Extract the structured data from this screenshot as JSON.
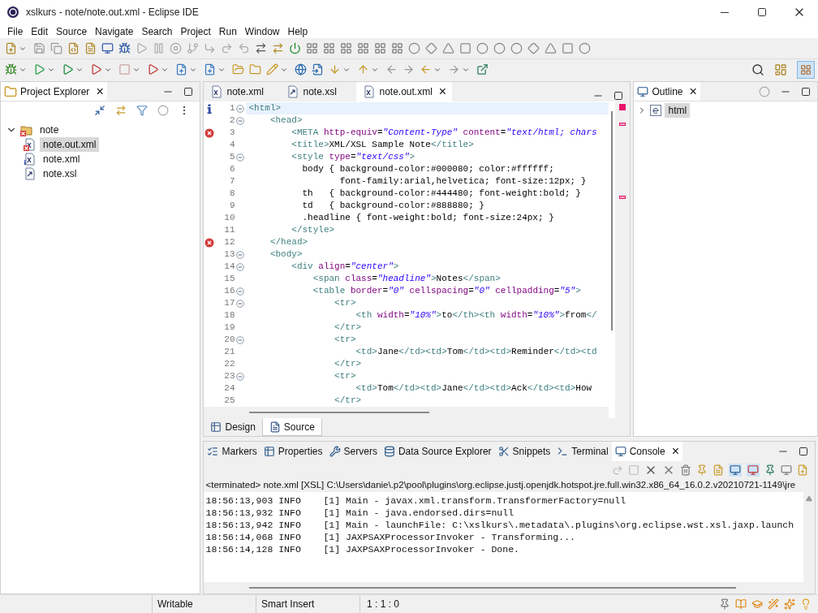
{
  "window": {
    "title": "xslkurs - note/note.out.xml - Eclipse IDE"
  },
  "menu": [
    "File",
    "Edit",
    "Source",
    "Navigate",
    "Search",
    "Project",
    "Run",
    "Window",
    "Help"
  ],
  "project_explorer": {
    "title": "Project Explorer",
    "close": "×",
    "tree": [
      {
        "label": "note",
        "expanded": true,
        "selected": false,
        "error": true,
        "info": false,
        "kind": "project",
        "children": [
          {
            "label": "note.out.xml",
            "selected": true,
            "error": true,
            "info": false,
            "kind": "xml"
          },
          {
            "label": "note.xml",
            "selected": false,
            "error": false,
            "info": true,
            "kind": "xml"
          },
          {
            "label": "note.xsl",
            "selected": false,
            "error": false,
            "info": false,
            "kind": "xsl"
          }
        ]
      }
    ]
  },
  "editor": {
    "tabs": [
      {
        "label": "note.xml",
        "selected": false,
        "kind": "xml"
      },
      {
        "label": "note.xsl",
        "selected": false,
        "kind": "xsl"
      },
      {
        "label": "note.out.xml",
        "selected": true,
        "kind": "xml",
        "close": "×"
      }
    ],
    "lines": [
      {
        "num": "1",
        "fold": true,
        "info": true,
        "error": false,
        "current": true,
        "code": "<html>"
      },
      {
        "num": "2",
        "fold": true,
        "info": false,
        "error": false,
        "current": false,
        "code": "    <head>"
      },
      {
        "num": "3",
        "fold": false,
        "info": false,
        "error": true,
        "current": false,
        "code": "        <META http-equiv=\"Content-Type\" content=\"text/html; chars"
      },
      {
        "num": "4",
        "fold": false,
        "info": false,
        "error": false,
        "current": false,
        "code": "        <title>XML/XSL Sample Note</title>"
      },
      {
        "num": "5",
        "fold": true,
        "info": false,
        "error": false,
        "current": false,
        "code": "        <style type=\"text/css\">"
      },
      {
        "num": "6",
        "fold": false,
        "info": false,
        "error": false,
        "current": false,
        "code": "          body { background-color:#000080; color:#ffffff;"
      },
      {
        "num": "7",
        "fold": false,
        "info": false,
        "error": false,
        "current": false,
        "code": "                 font-family:arial,helvetica; font-size:12px; }"
      },
      {
        "num": "8",
        "fold": false,
        "info": false,
        "error": false,
        "current": false,
        "code": "          th   { background-color:#444480; font-weight:bold; }"
      },
      {
        "num": "9",
        "fold": false,
        "info": false,
        "error": false,
        "current": false,
        "code": "          td   { background-color:#888880; }"
      },
      {
        "num": "10",
        "fold": false,
        "info": false,
        "error": false,
        "current": false,
        "code": "          .headline { font-weight:bold; font-size:24px; }"
      },
      {
        "num": "11",
        "fold": false,
        "info": false,
        "error": false,
        "current": false,
        "code": "        </style>"
      },
      {
        "num": "12",
        "fold": false,
        "info": false,
        "error": true,
        "current": false,
        "code": "    </head>"
      },
      {
        "num": "13",
        "fold": true,
        "info": false,
        "error": false,
        "current": false,
        "code": "    <body>"
      },
      {
        "num": "14",
        "fold": true,
        "info": false,
        "error": false,
        "current": false,
        "code": "        <div align=\"center\">"
      },
      {
        "num": "15",
        "fold": false,
        "info": false,
        "error": false,
        "current": false,
        "code": "            <span class=\"headline\">Notes</span>"
      },
      {
        "num": "16",
        "fold": true,
        "info": false,
        "error": false,
        "current": false,
        "code": "            <table border=\"0\" cellspacing=\"0\" cellpadding=\"5\">"
      },
      {
        "num": "17",
        "fold": true,
        "info": false,
        "error": false,
        "current": false,
        "code": "                <tr>"
      },
      {
        "num": "18",
        "fold": false,
        "info": false,
        "error": false,
        "current": false,
        "code": "                    <th width=\"10%\">to</th><th width=\"10%\">from</"
      },
      {
        "num": "19",
        "fold": false,
        "info": false,
        "error": false,
        "current": false,
        "code": "                </tr>"
      },
      {
        "num": "20",
        "fold": true,
        "info": false,
        "error": false,
        "current": false,
        "code": "                <tr>"
      },
      {
        "num": "21",
        "fold": false,
        "info": false,
        "error": false,
        "current": false,
        "code": "                    <td>Jane</td><td>Tom</td><td>Reminder</td><td"
      },
      {
        "num": "22",
        "fold": false,
        "info": false,
        "error": false,
        "current": false,
        "code": "                </tr>"
      },
      {
        "num": "23",
        "fold": true,
        "info": false,
        "error": false,
        "current": false,
        "code": "                <tr>"
      },
      {
        "num": "24",
        "fold": false,
        "info": false,
        "error": false,
        "current": false,
        "code": "                    <td>Tom</td><td>Jane</td><td>Ack</td><td>How"
      },
      {
        "num": "25",
        "fold": false,
        "info": false,
        "error": false,
        "current": false,
        "code": "                </tr>"
      }
    ],
    "mode_tabs": [
      {
        "label": "Design",
        "selected": false,
        "kind": "design"
      },
      {
        "label": "Source",
        "selected": true,
        "kind": "source"
      }
    ]
  },
  "outline": {
    "title": "Outline",
    "close": "×",
    "tree": [
      {
        "label": "html",
        "expanded": false,
        "selected": true
      }
    ]
  },
  "bottom": {
    "tabs": [
      {
        "label": "Markers",
        "selected": false,
        "kind": "markers"
      },
      {
        "label": "Properties",
        "selected": false,
        "kind": "properties"
      },
      {
        "label": "Servers",
        "selected": false,
        "kind": "servers"
      },
      {
        "label": "Data Source Explorer",
        "selected": false,
        "kind": "datasource"
      },
      {
        "label": "Snippets",
        "selected": false,
        "kind": "snippets"
      },
      {
        "label": "Terminal",
        "selected": false,
        "kind": "terminal"
      },
      {
        "label": "Console",
        "selected": true,
        "kind": "console",
        "close": "×"
      }
    ],
    "console_header": "<terminated> note.xml [XSL] C:\\Users\\danie\\.p2\\pool\\plugins\\org.eclipse.justj.openjdk.hotspot.jre.full.win32.x86_64_16.0.2.v20210721-1149\\jre",
    "log": [
      "18:56:13,903 INFO    [1] Main - javax.xml.transform.TransformerFactory=null",
      "18:56:13,932 INFO    [1] Main - java.endorsed.dirs=null",
      "18:56:13,942 INFO    [1] Main - launchFile: C:\\xslkurs\\.metadata\\.plugins\\org.eclipse.wst.xsl.jaxp.launch",
      "18:56:14,068 INFO    [1] JAXPSAXProcessorInvoker - Transforming...",
      "18:56:14,128 INFO    [1] JAXPSAXProcessorInvoker - Done."
    ]
  },
  "status_bar": {
    "mode": "Writable",
    "insert": "Smart Insert",
    "position": "1 : 1 : 0"
  }
}
